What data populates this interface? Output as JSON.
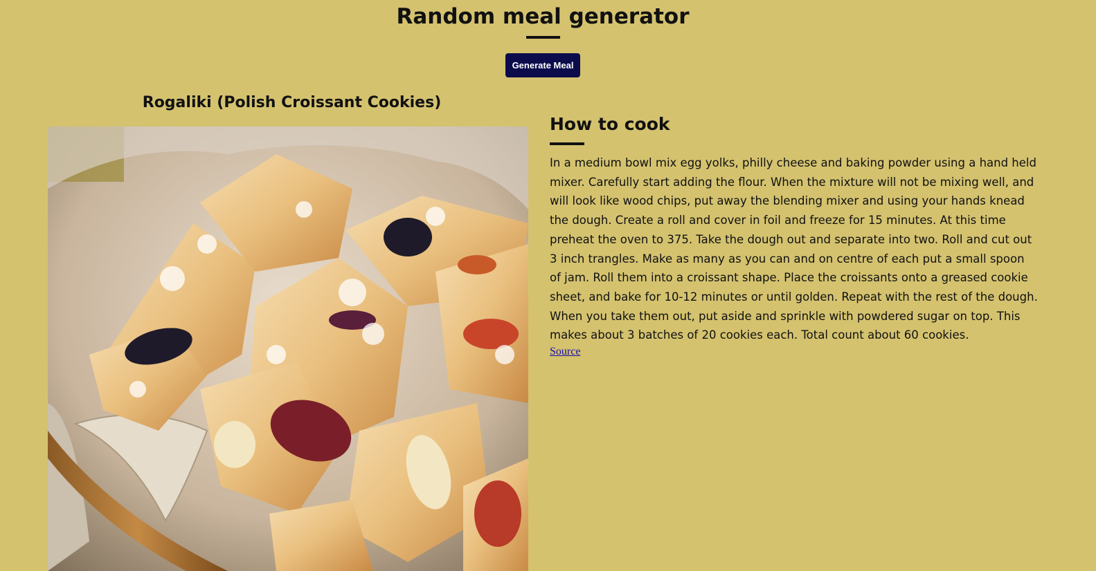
{
  "header": {
    "title": "Random meal generator",
    "generate_label": "Generate Meal"
  },
  "meal": {
    "name": "Rogaliki (Polish Croissant Cookies)",
    "image_icon": "meal-photo"
  },
  "howto": {
    "heading": "How to cook",
    "instructions": "In a medium bowl mix egg yolks, philly cheese and baking powder using a hand held mixer. Carefully start adding the flour. When the mixture will not be mixing well, and will look like wood chips, put away the blending mixer and using your hands knead the dough. Create a roll and cover in foil and freeze for 15 minutes. At this time preheat the oven to 375. Take the dough out and separate into two. Roll and cut out 3 inch trangles. Make as many as you can and on centre of each put a small spoon of jam. Roll them into a croissant shape. Place the croissants onto a greased cookie sheet, and bake for 10-12 minutes or until golden. Repeat with the rest of the dough. When you take them out, put aside and sprinkle with powdered sugar on top. This makes about 3 batches of 20 cookies each. Total count about 60 cookies.",
    "source_label": "Source"
  },
  "colors": {
    "background": "#d4c26f",
    "button": "#0c0c4d",
    "link": "#1a0dab"
  }
}
